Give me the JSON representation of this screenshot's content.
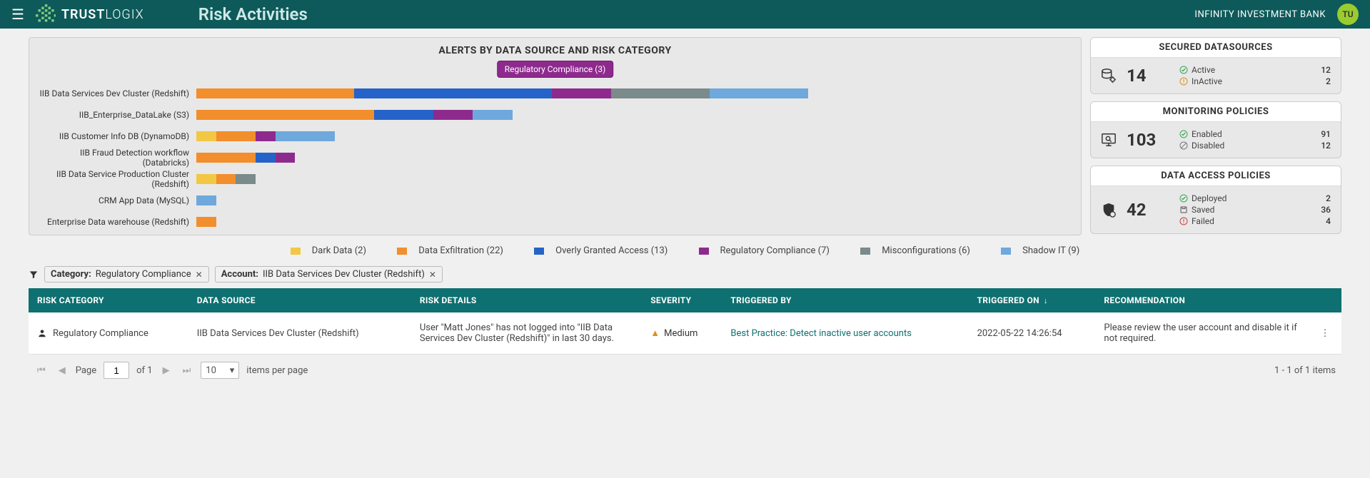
{
  "header": {
    "brand_prefix": "TRUST",
    "brand_suffix": "LOGIX",
    "page_title": "Risk Activities",
    "tenant": "INFINITY INVESTMENT BANK",
    "avatar": "TU"
  },
  "chart": {
    "title": "ALERTS BY DATA SOURCE AND RISK CATEGORY",
    "tooltip": "Regulatory Compliance (3)"
  },
  "chart_data": {
    "type": "bar",
    "orientation": "horizontal",
    "stacked": true,
    "categories": [
      "IIB Data Services Dev Cluster (Redshift)",
      "IIB_Enterprise_DataLake (S3)",
      "IIB Customer Info DB (DynamoDB)",
      "IIB Fraud Detection workflow (Databricks)",
      "IIB Data Service Production Cluster (Redshift)",
      "CRM App Data (MySQL)",
      "Enterprise Data warehouse (Redshift)"
    ],
    "series": [
      {
        "name": "Dark Data",
        "total": 2,
        "color": "#f2c744",
        "values": [
          0,
          0,
          1,
          0,
          1,
          0,
          0
        ]
      },
      {
        "name": "Data Exfiltration",
        "total": 22,
        "color": "#f28e2b",
        "values": [
          8,
          9,
          2,
          3,
          1,
          0,
          1
        ]
      },
      {
        "name": "Overly Granted Access",
        "total": 13,
        "color": "#2563c9",
        "values": [
          10,
          3,
          0,
          1,
          0,
          0,
          0
        ]
      },
      {
        "name": "Regulatory Compliance",
        "total": 7,
        "color": "#8e2a8e",
        "values": [
          3,
          2,
          1,
          1,
          0,
          0,
          0
        ]
      },
      {
        "name": "Misconfigurations",
        "total": 6,
        "color": "#7b8a8a",
        "values": [
          5,
          0,
          0,
          0,
          1,
          0,
          0
        ]
      },
      {
        "name": "Shadow IT",
        "total": 9,
        "color": "#6fa8dc",
        "values": [
          5,
          2,
          3,
          0,
          0,
          1,
          0
        ]
      }
    ],
    "xlabel": "",
    "ylabel": "",
    "legend_position": "bottom"
  },
  "legend": {
    "dark": "Dark Data (2)",
    "exfil": "Data Exfiltration (22)",
    "overly": "Overly Granted Access (13)",
    "reg": "Regulatory Compliance (7)",
    "misconf": "Misconfigurations (6)",
    "shadow": "Shadow IT (9)"
  },
  "cards": {
    "secured": {
      "title": "SECURED DATASOURCES",
      "value": "14",
      "statuses": [
        {
          "label": "Active",
          "count": "12",
          "icon": "check-green"
        },
        {
          "label": "InActive",
          "count": "2",
          "icon": "warn-orange"
        }
      ]
    },
    "monitor": {
      "title": "MONITORING POLICIES",
      "value": "103",
      "statuses": [
        {
          "label": "Enabled",
          "count": "91",
          "icon": "check-green"
        },
        {
          "label": "Disabled",
          "count": "12",
          "icon": "disabled-gray"
        }
      ]
    },
    "access": {
      "title": "DATA ACCESS POLICIES",
      "value": "42",
      "statuses": [
        {
          "label": "Deployed",
          "count": "2",
          "icon": "check-green"
        },
        {
          "label": "Saved",
          "count": "36",
          "icon": "save-gray"
        },
        {
          "label": "Failed",
          "count": "4",
          "icon": "fail-red"
        }
      ]
    }
  },
  "filters": [
    {
      "key": "Category:",
      "value": "Regulatory Compliance"
    },
    {
      "key": "Account:",
      "value": "IIB Data Services Dev Cluster (Redshift)"
    }
  ],
  "table": {
    "headers": {
      "risk_category": "RISK CATEGORY",
      "data_source": "DATA SOURCE",
      "risk_details": "RISK DETAILS",
      "severity": "SEVERITY",
      "triggered_by": "TRIGGERED BY",
      "triggered_on": "TRIGGERED ON",
      "recommendation": "RECOMMENDATION"
    },
    "rows": [
      {
        "risk_category": "Regulatory Compliance",
        "data_source": "IIB Data Services Dev Cluster (Redshift)",
        "risk_details": "User \"Matt Jones\" has not logged into \"IIB Data Services Dev Cluster (Redshift)\" in last 30 days.",
        "severity": "Medium",
        "triggered_by": "Best Practice: Detect inactive user accounts",
        "triggered_on": "2022-05-22 14:26:54",
        "recommendation": "Please review the user account and disable it if not required."
      }
    ]
  },
  "pager": {
    "page_word": "Page",
    "page": "1",
    "of_word": "of",
    "total_pages": "1",
    "per_page": "10",
    "per_page_label": "items per page",
    "range": "1 - 1 of 1 items"
  }
}
